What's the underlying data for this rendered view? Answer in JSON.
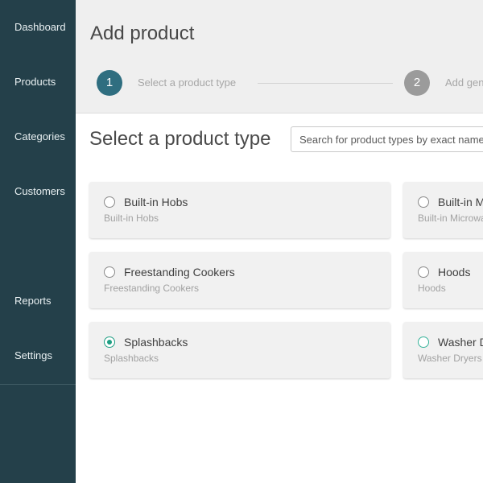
{
  "sidebar": {
    "items": [
      {
        "label": "Dashboard"
      },
      {
        "label": "Products"
      },
      {
        "label": "Categories"
      },
      {
        "label": "Customers"
      },
      {
        "label": "Reports"
      },
      {
        "label": "Settings"
      }
    ]
  },
  "header": {
    "title": "Add product",
    "steps": [
      {
        "number": "1",
        "label": "Select a product type"
      },
      {
        "number": "2",
        "label": "Add general details"
      }
    ]
  },
  "main": {
    "section_title": "Select a product type",
    "search": {
      "placeholder": "Search for product types by exact name",
      "value": ""
    },
    "product_types": [
      {
        "title": "Built-in Hobs",
        "subtitle": "Built-in Hobs",
        "selected": false
      },
      {
        "title": "Built-in Microwaves",
        "subtitle": "Built-in Microwaves",
        "selected": false
      },
      {
        "title": "Freestanding Cookers",
        "subtitle": "Freestanding Cookers",
        "selected": false
      },
      {
        "title": "Hoods",
        "subtitle": "Hoods",
        "selected": false
      },
      {
        "title": "Splashbacks",
        "subtitle": "Splashbacks",
        "selected": true
      },
      {
        "title": "Washer Dryers",
        "subtitle": "Washer Dryers",
        "selected": false
      }
    ]
  },
  "colors": {
    "sidebar_bg": "#24404a",
    "step_active": "#2f6e80",
    "step_inactive": "#9b9b9b",
    "radio_selected": "#1f9e83"
  }
}
